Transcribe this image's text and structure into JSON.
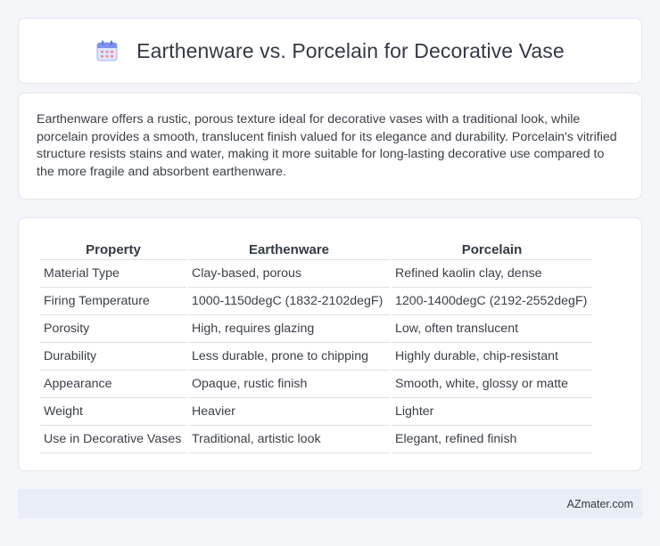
{
  "header": {
    "icon": "calendar-icon",
    "title": "Earthenware vs. Porcelain for Decorative Vase"
  },
  "summary": {
    "text": "Earthenware offers a rustic, porous texture ideal for decorative vases with a traditional look, while porcelain provides a smooth, translucent finish valued for its elegance and durability. Porcelain's vitrified structure resists stains and water, making it more suitable for long-lasting decorative use compared to the more fragile and absorbent earthenware."
  },
  "table": {
    "headers": [
      "Property",
      "Earthenware",
      "Porcelain"
    ],
    "rows": [
      [
        "Material Type",
        "Clay-based, porous",
        "Refined kaolin clay, dense"
      ],
      [
        "Firing Temperature",
        "1000-1150degC (1832-2102degF)",
        "1200-1400degC (2192-2552degF)"
      ],
      [
        "Porosity",
        "High, requires glazing",
        "Low, often translucent"
      ],
      [
        "Durability",
        "Less durable, prone to chipping",
        "Highly durable, chip-resistant"
      ],
      [
        "Appearance",
        "Opaque, rustic finish",
        "Smooth, white, glossy or matte"
      ],
      [
        "Weight",
        "Heavier",
        "Lighter"
      ],
      [
        "Use in Decorative Vases",
        "Traditional, artistic look",
        "Elegant, refined finish"
      ]
    ]
  },
  "footer": {
    "text": "AZmater.com"
  },
  "colors": {
    "background": "#f3f5f9",
    "card": "#ffffff",
    "footer": "#e8edf6",
    "icon_top": "#6f8cf0",
    "icon_body": "#c9d4fb"
  }
}
